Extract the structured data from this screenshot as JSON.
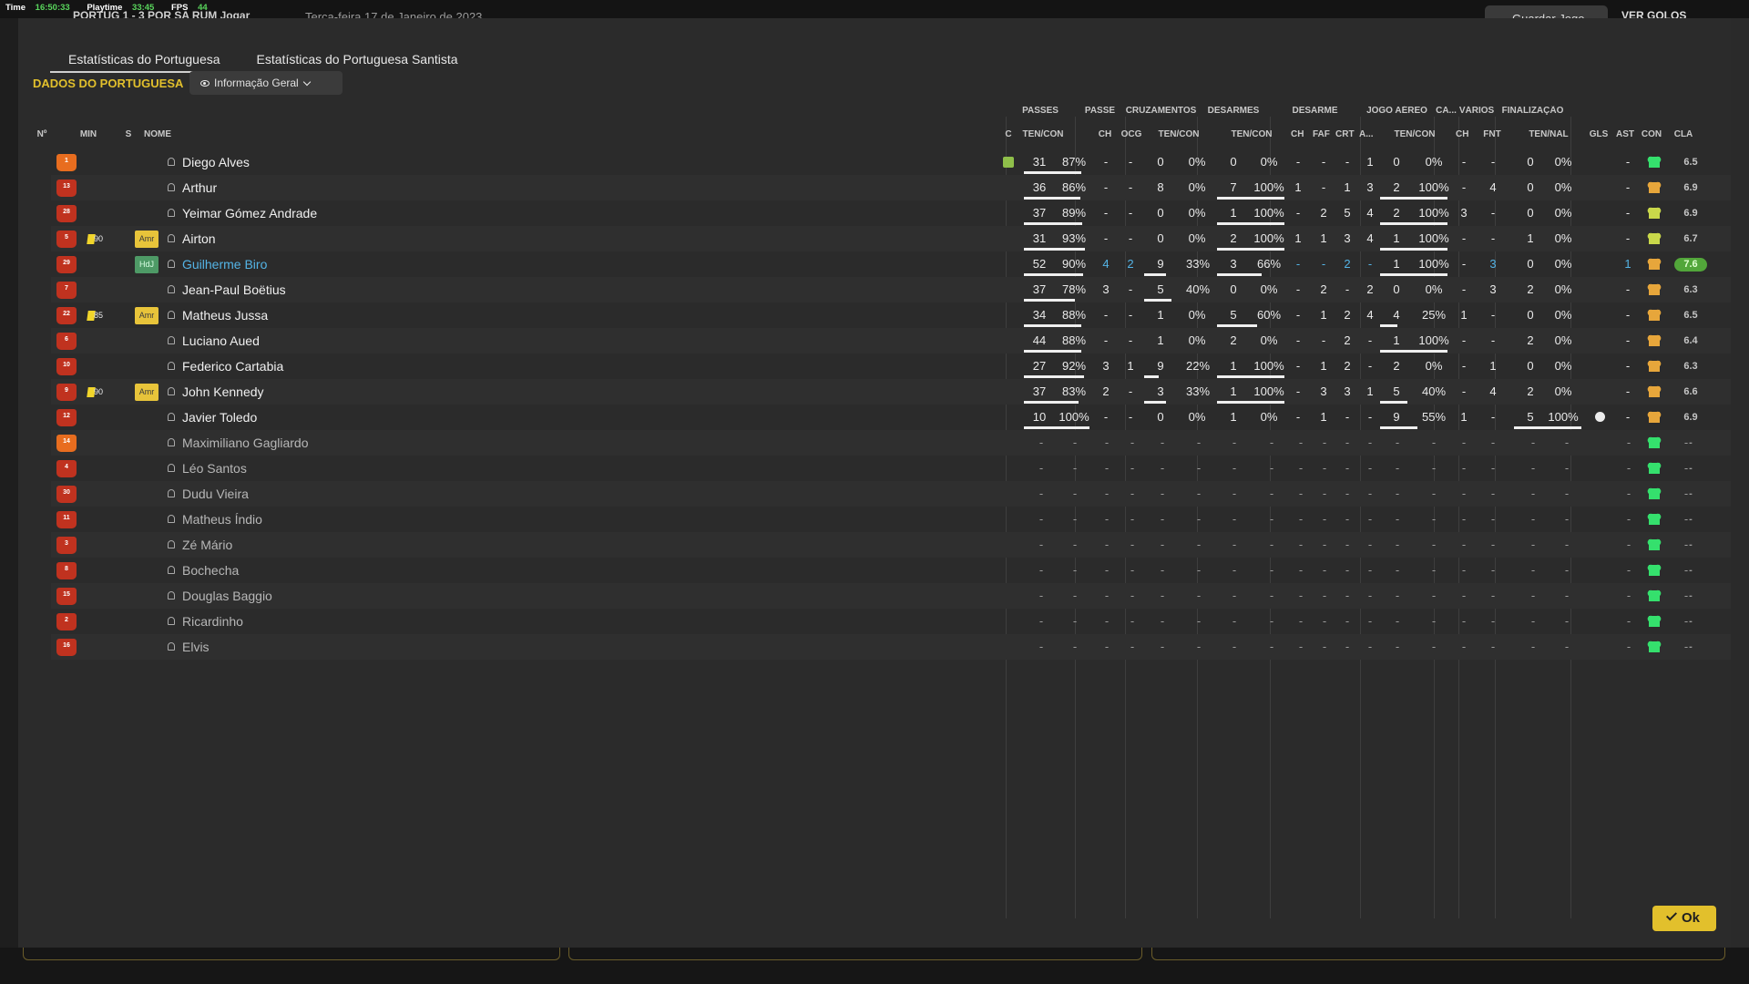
{
  "topbar": {
    "time_label": "Time",
    "time_value": "16:50:33",
    "playtime_label": "Playtime",
    "playtime_value": "33:45",
    "fps_label": "FPS",
    "fps_value": "44",
    "score": "PORTUG  1 - 3  POR SA   RUM Jogar",
    "date": "Terça-feira 17 de Janeiro de 2023",
    "save_label": "Guardar Jogo",
    "goals_label": "VER GOLOS"
  },
  "tabs": [
    "Estatísticas do Portuguesa",
    "Estatísticas do Portuguesa Santista"
  ],
  "team_title": "DADOS DO PORTUGUESA",
  "view_select": "Informação Geral",
  "group_headers": [
    "PASSES",
    "PASSE",
    "CRUZAMENTOS",
    "DESARMES",
    "DESARME",
    "JOGO AÉREO",
    "CA...",
    "VÁRIOS",
    "FINALIZAÇÃO"
  ],
  "sub_headers": {
    "num": "Nº",
    "min": "MIN",
    "s": "S",
    "name": "NOME",
    "c": "C",
    "passes": "TEN/CON",
    "pass_ch": "CH",
    "pass_ocg": "OCG",
    "crosses": "TEN/CON",
    "tackles": "TEN/CON",
    "tk_ch": "CH",
    "tk_faf": "FAF",
    "tk_crt": "CRT",
    "tk_a": "A...",
    "aerial": "TEN/CON",
    "ca_ch": "CH",
    "fnt": "FNT",
    "shots": "TEN/NAL",
    "gls": "GLS",
    "ast": "AST",
    "con": "CON",
    "cla": "CLA"
  },
  "players": [
    {
      "num": "1",
      "min": "",
      "card": false,
      "badge": "",
      "name": "Diego Alves",
      "gk": true,
      "captain_icon": true,
      "p_t": "31",
      "p_p": "87%",
      "ch": "-",
      "ocg": "-",
      "cr_t": "0",
      "cr_p": "0%",
      "ds_t": "0",
      "ds_p": "0%",
      "tch": "-",
      "faf": "-",
      "crt": "-",
      "a": "1",
      "ae_t": "0",
      "ae_p": "0%",
      "cach": "-",
      "fnt": "-",
      "sh_t": "0",
      "sh_p": "0%",
      "gls": "",
      "ast": "-",
      "con": "green",
      "cla": "6.5",
      "bars": {
        "p": 0.87,
        "cr": 0,
        "ds": 0,
        "ae": 0,
        "sh": 0
      }
    },
    {
      "num": "13",
      "min": "",
      "card": false,
      "badge": "",
      "name": "Arthur",
      "gk": false,
      "p_t": "36",
      "p_p": "86%",
      "ch": "-",
      "ocg": "-",
      "cr_t": "8",
      "cr_p": "0%",
      "ds_t": "7",
      "ds_p": "100%",
      "tch": "1",
      "faf": "-",
      "crt": "1",
      "a": "3",
      "ae_t": "2",
      "ae_p": "100%",
      "cach": "-",
      "fnt": "4",
      "sh_t": "0",
      "sh_p": "0%",
      "gls": "",
      "ast": "-",
      "con": "gold",
      "cla": "6.9",
      "bars": {
        "p": 0.86,
        "cr": 0,
        "ds": 1,
        "ae": 1,
        "sh": 0
      }
    },
    {
      "num": "28",
      "min": "",
      "card": false,
      "badge": "",
      "name": "Yeimar Gómez Andrade",
      "gk": false,
      "p_t": "37",
      "p_p": "89%",
      "ch": "-",
      "ocg": "-",
      "cr_t": "0",
      "cr_p": "0%",
      "ds_t": "1",
      "ds_p": "100%",
      "tch": "-",
      "faf": "2",
      "crt": "5",
      "a": "4",
      "ae_t": "2",
      "ae_p": "100%",
      "cach": "3",
      "fnt": "-",
      "sh_t": "0",
      "sh_p": "0%",
      "gls": "",
      "ast": "-",
      "con": "lime",
      "cla": "6.9",
      "bars": {
        "p": 0.89,
        "cr": 0,
        "ds": 1,
        "ae": 1,
        "sh": 0
      }
    },
    {
      "num": "5",
      "min": "90",
      "card": true,
      "badge": "Amr",
      "name": "Airton",
      "gk": false,
      "p_t": "31",
      "p_p": "93%",
      "ch": "-",
      "ocg": "-",
      "cr_t": "0",
      "cr_p": "0%",
      "ds_t": "2",
      "ds_p": "100%",
      "tch": "1",
      "faf": "1",
      "crt": "3",
      "a": "4",
      "ae_t": "1",
      "ae_p": "100%",
      "cach": "-",
      "fnt": "-",
      "sh_t": "1",
      "sh_p": "0%",
      "gls": "",
      "ast": "-",
      "con": "lime",
      "cla": "6.7",
      "bars": {
        "p": 0.93,
        "cr": 0,
        "ds": 1,
        "ae": 1,
        "sh": 0
      }
    },
    {
      "num": "29",
      "min": "",
      "card": false,
      "badge": "HdJ",
      "name": "Guilherme Biro",
      "gk": false,
      "highlight": true,
      "p_t": "52",
      "p_p": "90%",
      "ch": "4",
      "ocg": "2",
      "cr_t": "9",
      "cr_p": "33%",
      "ds_t": "3",
      "ds_p": "66%",
      "tch": "-",
      "faf": "-",
      "crt": "2",
      "a": "-",
      "ae_t": "1",
      "ae_p": "100%",
      "cach": "-",
      "fnt": "3",
      "sh_t": "0",
      "sh_p": "0%",
      "gls": "",
      "ast": "1",
      "con": "gold",
      "cla": "7.6",
      "best": true,
      "bars": {
        "p": 0.9,
        "cr": 0.33,
        "ds": 0.66,
        "ae": 1,
        "sh": 0
      }
    },
    {
      "num": "7",
      "min": "",
      "card": false,
      "badge": "",
      "name": "Jean-Paul Boëtius",
      "gk": false,
      "p_t": "37",
      "p_p": "78%",
      "ch": "3",
      "ocg": "-",
      "cr_t": "5",
      "cr_p": "40%",
      "ds_t": "0",
      "ds_p": "0%",
      "tch": "-",
      "faf": "2",
      "crt": "-",
      "a": "2",
      "ae_t": "0",
      "ae_p": "0%",
      "cach": "-",
      "fnt": "3",
      "sh_t": "2",
      "sh_p": "0%",
      "gls": "",
      "ast": "-",
      "con": "gold",
      "cla": "6.3",
      "bars": {
        "p": 0.78,
        "cr": 0.4,
        "ds": 0,
        "ae": 0,
        "sh": 0
      }
    },
    {
      "num": "22",
      "min": "85",
      "card": true,
      "badge": "Amr",
      "name": "Matheus Jussa",
      "gk": false,
      "p_t": "34",
      "p_p": "88%",
      "ch": "-",
      "ocg": "-",
      "cr_t": "1",
      "cr_p": "0%",
      "ds_t": "5",
      "ds_p": "60%",
      "tch": "-",
      "faf": "1",
      "crt": "2",
      "a": "4",
      "ae_t": "4",
      "ae_p": "25%",
      "cach": "1",
      "fnt": "-",
      "sh_t": "0",
      "sh_p": "0%",
      "gls": "",
      "ast": "-",
      "con": "gold",
      "cla": "6.5",
      "bars": {
        "p": 0.88,
        "cr": 0,
        "ds": 0.6,
        "ae": 0.25,
        "sh": 0
      }
    },
    {
      "num": "6",
      "min": "",
      "card": false,
      "badge": "",
      "name": "Luciano Aued",
      "gk": false,
      "p_t": "44",
      "p_p": "88%",
      "ch": "-",
      "ocg": "-",
      "cr_t": "1",
      "cr_p": "0%",
      "ds_t": "2",
      "ds_p": "0%",
      "tch": "-",
      "faf": "-",
      "crt": "2",
      "a": "-",
      "ae_t": "1",
      "ae_p": "100%",
      "cach": "-",
      "fnt": "-",
      "sh_t": "2",
      "sh_p": "0%",
      "gls": "",
      "ast": "-",
      "con": "gold",
      "cla": "6.4",
      "bars": {
        "p": 0.88,
        "cr": 0,
        "ds": 0,
        "ae": 1,
        "sh": 0
      }
    },
    {
      "num": "10",
      "min": "",
      "card": false,
      "badge": "",
      "name": "Federico Cartabia",
      "gk": false,
      "p_t": "27",
      "p_p": "92%",
      "ch": "3",
      "ocg": "1",
      "cr_t": "9",
      "cr_p": "22%",
      "ds_t": "1",
      "ds_p": "100%",
      "tch": "-",
      "faf": "1",
      "crt": "2",
      "a": "-",
      "ae_t": "2",
      "ae_p": "0%",
      "cach": "-",
      "fnt": "1",
      "sh_t": "0",
      "sh_p": "0%",
      "gls": "",
      "ast": "-",
      "con": "gold",
      "cla": "6.3",
      "bars": {
        "p": 0.92,
        "cr": 0.22,
        "ds": 1,
        "ae": 0,
        "sh": 0
      }
    },
    {
      "num": "9",
      "min": "90",
      "card": true,
      "badge": "Amr",
      "name": "John Kennedy",
      "gk": false,
      "p_t": "37",
      "p_p": "83%",
      "ch": "2",
      "ocg": "-",
      "cr_t": "3",
      "cr_p": "33%",
      "ds_t": "1",
      "ds_p": "100%",
      "tch": "-",
      "faf": "3",
      "crt": "3",
      "a": "1",
      "ae_t": "5",
      "ae_p": "40%",
      "cach": "-",
      "fnt": "4",
      "sh_t": "2",
      "sh_p": "0%",
      "gls": "",
      "ast": "-",
      "con": "gold",
      "cla": "6.6",
      "bars": {
        "p": 0.83,
        "cr": 0.33,
        "ds": 1,
        "ae": 0.4,
        "sh": 0
      }
    },
    {
      "num": "12",
      "min": "",
      "card": false,
      "badge": "",
      "name": "Javier Toledo",
      "gk": false,
      "p_t": "10",
      "p_p": "100%",
      "ch": "-",
      "ocg": "-",
      "cr_t": "0",
      "cr_p": "0%",
      "ds_t": "1",
      "ds_p": "0%",
      "tch": "-",
      "faf": "1",
      "crt": "-",
      "a": "-",
      "ae_t": "9",
      "ae_p": "55%",
      "cach": "1",
      "fnt": "-",
      "sh_t": "5",
      "sh_p": "100%",
      "gls": "ball",
      "ast": "-",
      "con": "gold",
      "cla": "6.9",
      "bars": {
        "p": 1,
        "cr": 0,
        "ds": 0,
        "ae": 0.55,
        "sh": 1
      }
    },
    {
      "num": "14",
      "sub": true,
      "gk": true,
      "name": "Maximiliano Gagliardo",
      "con": "green"
    },
    {
      "num": "4",
      "sub": true,
      "name": "Léo Santos",
      "con": "green"
    },
    {
      "num": "30",
      "sub": true,
      "name": "Dudu Vieira",
      "con": "green"
    },
    {
      "num": "11",
      "sub": true,
      "name": "Matheus Índio",
      "con": "green"
    },
    {
      "num": "3",
      "sub": true,
      "name": "Zé Mário",
      "con": "green"
    },
    {
      "num": "8",
      "sub": true,
      "name": "Bochecha",
      "con": "green"
    },
    {
      "num": "15",
      "sub": true,
      "name": "Douglas Baggio",
      "con": "green"
    },
    {
      "num": "2",
      "sub": true,
      "name": "Ricardinho",
      "con": "green"
    },
    {
      "num": "16",
      "sub": true,
      "name": "Elvis",
      "con": "green"
    }
  ],
  "dash": "-",
  "ok_label": "Ok",
  "colors": {
    "accent": "#e2c02c",
    "highlight": "#54b4e6",
    "best_rating": "#52a63a"
  }
}
